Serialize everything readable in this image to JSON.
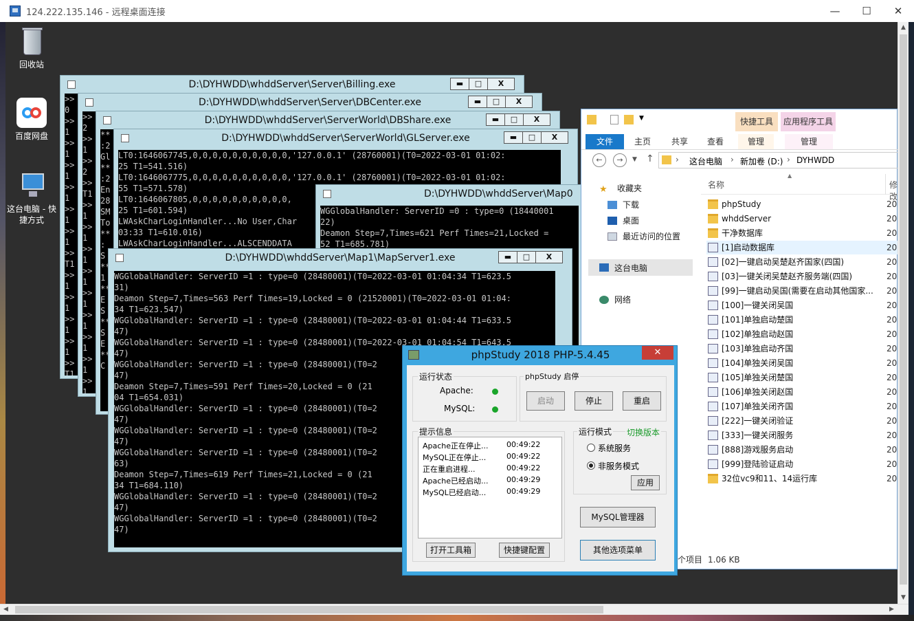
{
  "rdp": {
    "title": "124.222.135.146 - 远程桌面连接"
  },
  "desktop": {
    "icons": [
      {
        "label": "回收站"
      },
      {
        "label": "百度网盘"
      },
      {
        "label": "这台电脑 - 快捷方式"
      }
    ]
  },
  "consoles": [
    {
      "title": "D:\\DYHWDD\\whddServer\\Server\\Billing.exe",
      "lines": [
        ">>",
        "0",
        ">>",
        "1",
        ">>",
        "1",
        ">>",
        "1",
        ">>",
        "1",
        ">>",
        "1",
        ">>",
        "1",
        ">>",
        "T1",
        ">>",
        "1",
        ">>",
        "1",
        ">>",
        "1",
        ">>",
        "1",
        ">>",
        "T1",
        ">>",
        "1",
        ">>",
        "1",
        ">>",
        "1"
      ]
    },
    {
      "title": "D:\\DYHWDD\\whddServer\\Server\\DBCenter.exe",
      "lines": [
        ">>",
        "2",
        ">>",
        "1",
        ">>",
        "2",
        ">>",
        "T1",
        ">>",
        "1",
        ">>",
        "1",
        ">>",
        "1",
        ">>",
        "1",
        ">>",
        "1",
        ">>",
        "1",
        ">>",
        "1",
        ">>",
        "1",
        ">>",
        "1",
        ">>",
        "1",
        ">>",
        "1",
        ">>",
        "1",
        ">>",
        "2",
        ">>",
        "2"
      ]
    },
    {
      "title": "D:\\DYHWDD\\whddServer\\ServerWorld\\DBShare.exe",
      "lines": [
        "**",
        ":2",
        "Gl",
        "**",
        ":2",
        "En",
        "28",
        "SM",
        "To",
        "**",
        ":",
        "S",
        "**",
        "1",
        "**",
        "E",
        "S",
        "**",
        "S",
        "E",
        "**",
        "C"
      ]
    },
    {
      "title": "D:\\DYHWDD\\whddServer\\ServerWorld\\GLServer.exe",
      "lines": [
        "LT0:1646067745,0,0,0,0,0,0,0,0,0,0,'127.0.0.1' (28760001)(T0=2022-03-01 01:02:",
        "25 T1=541.516)",
        "LT0:1646067775,0,0,0,0,0,0,0,0,0,0,'127.0.0.1' (28760001)(T0=2022-03-01 01:02:",
        "55 T1=571.578)",
        "LT0:1646067805,0,0,0,0,0,0,0,0,0,0,",
        "25 T1=601.594)",
        "LWAskCharLoginHandler...No User,Char",
        "03:33 T1=610.016)",
        "LWAskCharLoginHandler...ALSCENDDATA"
      ]
    },
    {
      "title": "D:\\DYHWDD\\whddServer\\Map0",
      "lines": [
        "WGGlobalHandler: ServerID =0 : type=0 (18440001",
        "22)",
        "Deamon Step=7,Times=621 Perf Times=21,Locked = ",
        "52 T1=685.781)"
      ]
    },
    {
      "title": "D:\\DYHWDD\\whddServer\\Map1\\MapServer1.exe",
      "lines": [
        "WGGlobalHandler: ServerID =1 : type=0 (28480001)(T0=2022-03-01 01:04:34 T1=623.5",
        "31)",
        "Deamon Step=7,Times=563 Perf Times=19,Locked = 0 (21520001)(T0=2022-03-01 01:04:",
        "34 T1=623.547)",
        "WGGlobalHandler: ServerID =1 : type=0 (28480001)(T0=2022-03-01 01:04:44 T1=633.5",
        "47)",
        "WGGlobalHandler: ServerID =1 : type=0 (28480001)(T0=2022-03-01 01:04:54 T1=643.5",
        "47)",
        "WGGlobalHandler: ServerID =1 : type=0 (28480001)(T0=2",
        "47)",
        "Deamon Step=7,Times=591 Perf Times=20,Locked = 0 (21",
        "04 T1=654.031)",
        "WGGlobalHandler: ServerID =1 : type=0 (28480001)(T0=2",
        "47)",
        "WGGlobalHandler: ServerID =1 : type=0 (28480001)(T0=2",
        "47)",
        "WGGlobalHandler: ServerID =1 : type=0 (28480001)(T0=2",
        "63)",
        "Deamon Step=7,Times=619 Perf Times=21,Locked = 0 (21",
        "34 T1=684.110)",
        "WGGlobalHandler: ServerID =1 : type=0 (28480001)(T0=2",
        "47)",
        "WGGlobalHandler: ServerID =1 : type=0 (28480001)(T0=2",
        "47)"
      ]
    }
  ],
  "explorer": {
    "ctx_tabs": [
      "快捷工具",
      "应用程序工具"
    ],
    "tabs": [
      "文件",
      "主页",
      "共享",
      "查看",
      "管理",
      "管理"
    ],
    "path": [
      "这台电脑",
      "新加卷 (D:)",
      "DYHWDD"
    ],
    "column": "名称",
    "column2": "修改",
    "nav": [
      "收藏夹",
      "下载",
      "桌面",
      "最近访问的位置",
      "这台电脑",
      "网络"
    ],
    "files": [
      {
        "name": "phpStudy",
        "date": "20",
        "kind": "folder"
      },
      {
        "name": "whddServer",
        "date": "20",
        "kind": "folder"
      },
      {
        "name": "干净数据库",
        "date": "20",
        "kind": "folder"
      },
      {
        "name": "[1]启动数据库",
        "date": "20",
        "kind": "shortcut"
      },
      {
        "name": "[02]一键启动吴楚赵齐国家(四国)",
        "date": "20",
        "kind": "shortcut"
      },
      {
        "name": "[03]一键关闭吴楚赵齐服务端(四国)",
        "date": "20",
        "kind": "shortcut"
      },
      {
        "name": "[99]一键启动吴国(需要在启动其他国家...",
        "date": "20",
        "kind": "shortcut"
      },
      {
        "name": "[100]一键关闭吴国",
        "date": "20",
        "kind": "shortcut"
      },
      {
        "name": "[101]单独启动楚国",
        "date": "20",
        "kind": "shortcut"
      },
      {
        "name": "[102]单独启动赵国",
        "date": "20",
        "kind": "shortcut"
      },
      {
        "name": "[103]单独启动齐国",
        "date": "20",
        "kind": "shortcut"
      },
      {
        "name": "[104]单独关闭吴国",
        "date": "20",
        "kind": "shortcut"
      },
      {
        "name": "[105]单独关闭楚国",
        "date": "20",
        "kind": "shortcut"
      },
      {
        "name": "[106]单独关闭赵国",
        "date": "20",
        "kind": "shortcut"
      },
      {
        "name": "[107]单独关闭齐国",
        "date": "20",
        "kind": "shortcut"
      },
      {
        "name": "[222]一键关闭验证",
        "date": "20",
        "kind": "shortcut"
      },
      {
        "name": "[333]一键关闭服务",
        "date": "20",
        "kind": "shortcut"
      },
      {
        "name": "[888]游戏服务启动",
        "date": "20",
        "kind": "shortcut"
      },
      {
        "name": "[999]登陆验证启动",
        "date": "20",
        "kind": "shortcut"
      },
      {
        "name": "32位vc9和11、14运行库",
        "date": "20",
        "kind": "folder"
      }
    ],
    "status_items": "个项目",
    "status_size": "1.06 KB"
  },
  "phpstudy": {
    "title": "phpStudy 2018   PHP-5.4.45",
    "run_state": "运行状态",
    "apache": "Apache:",
    "mysql": "MySQL:",
    "start_group": "phpStudy 启停",
    "btn_start": "启动",
    "btn_stop": "停止",
    "btn_restart": "重启",
    "info_group": "提示信息",
    "log": [
      {
        "msg": "Apache正在停止...",
        "time": "00:49:22"
      },
      {
        "msg": "MySQL正在停止...",
        "time": "00:49:22"
      },
      {
        "msg": "正在重启进程...",
        "time": "00:49:22"
      },
      {
        "msg": "Apache已经启动...",
        "time": "00:49:29"
      },
      {
        "msg": "MySQL已经启动...",
        "time": "00:49:29"
      }
    ],
    "mode_group": "运行模式",
    "switch_version": "切换版本",
    "mode_service": "系统服务",
    "mode_nonservice": "非服务模式",
    "btn_apply": "应用",
    "btn_mysql": "MySQL管理器",
    "btn_toolbox": "打开工具箱",
    "btn_shortcut": "快捷键配置",
    "btn_other": "其他选项菜单",
    "running_color": "#1aa52a"
  }
}
